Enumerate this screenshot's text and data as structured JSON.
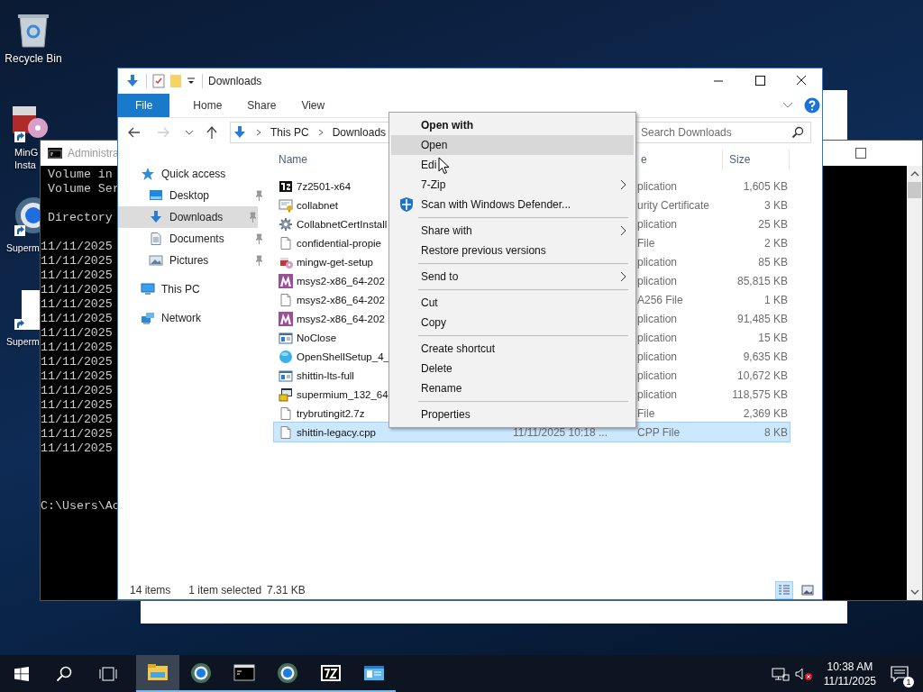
{
  "desktop_icons": [
    {
      "kind": "recycle",
      "lines": [
        "Recycle Bin"
      ]
    },
    {
      "kind": "installer",
      "lines": [
        "MinG",
        "Insta"
      ]
    },
    {
      "kind": "browser",
      "lines": [
        "Superm"
      ]
    },
    {
      "kind": "blank",
      "lines": [
        "Superm"
      ]
    }
  ],
  "console": {
    "title": "Administra",
    "header_lines": [
      "Volume in",
      "Volume Ser"
    ],
    "directory": "Directory",
    "listing": [
      "11/11/2025",
      "11/11/2025",
      "11/11/2025",
      "11/11/2025",
      "11/11/2025",
      "11/11/2025",
      "11/11/2025",
      "11/11/2025",
      "11/11/2025",
      "11/11/2025",
      "11/11/2025",
      "11/11/2025",
      "11/11/2025",
      "11/11/2025",
      "11/11/2025"
    ],
    "prompt": "C:\\Users\\Ac"
  },
  "explorer": {
    "title": "Downloads",
    "ribbon_tabs": [
      {
        "label": "File",
        "kind": "file"
      },
      {
        "label": "Home",
        "kind": "tab"
      },
      {
        "label": "Share",
        "kind": "tab"
      },
      {
        "label": "View",
        "kind": "tab"
      }
    ],
    "address": {
      "crumbs": [
        "This PC",
        "Downloads"
      ]
    },
    "search": {
      "placeholder": "Search Downloads"
    },
    "nav": [
      {
        "label": "Quick access",
        "kind": "star",
        "selected": false,
        "children": [
          {
            "label": "Desktop",
            "kind": "desktop",
            "pinned": true,
            "selected": false
          },
          {
            "label": "Downloads",
            "kind": "downloads",
            "pinned": true,
            "selected": true
          },
          {
            "label": "Documents",
            "kind": "documents",
            "pinned": true,
            "selected": false
          },
          {
            "label": "Pictures",
            "kind": "pictures",
            "pinned": true,
            "selected": false
          }
        ]
      },
      {
        "label": "This PC",
        "kind": "pc",
        "selected": false
      },
      {
        "label": "Network",
        "kind": "network",
        "selected": false
      }
    ],
    "columns": [
      "Name",
      "e",
      "Size"
    ],
    "files": [
      {
        "name": "7z2501-x64",
        "kind": "sevenzip",
        "type": "plication",
        "size": "1,605 KB",
        "selected": false
      },
      {
        "name": "collabnet",
        "kind": "cert",
        "type": "urity Certificate",
        "size": "3 KB",
        "selected": false
      },
      {
        "name": "CollabnetCertInstall",
        "kind": "gear",
        "type": "plication",
        "size": "25 KB",
        "selected": false
      },
      {
        "name": "confidential-propie",
        "kind": "doc",
        "type": "File",
        "size": "2 KB",
        "selected": false
      },
      {
        "name": "mingw-get-setup",
        "kind": "installer",
        "type": "plication",
        "size": "85 KB",
        "selected": false
      },
      {
        "name": "msys2-x86_64-202",
        "kind": "msys",
        "type": "plication",
        "size": "85,815 KB",
        "selected": false
      },
      {
        "name": "msys2-x86_64-202",
        "kind": "doc",
        "type": "A256 File",
        "size": "1 KB",
        "selected": false
      },
      {
        "name": "msys2-x86_64-202",
        "kind": "msys",
        "type": "plication",
        "size": "91,485 KB",
        "selected": false
      },
      {
        "name": "NoClose",
        "kind": "app",
        "type": "plication",
        "size": "15 KB",
        "selected": false
      },
      {
        "name": "OpenShellSetup_4_",
        "kind": "orb",
        "type": "plication",
        "size": "9,635 KB",
        "selected": false
      },
      {
        "name": "shittin-lts-full",
        "kind": "app",
        "type": "plication",
        "size": "10,672 KB",
        "selected": false
      },
      {
        "name": "supermium_132_64",
        "kind": "setup",
        "type": "plication",
        "size": "118,575 KB",
        "selected": false
      },
      {
        "name": "trybrutingit2.7z",
        "kind": "doc",
        "type": "File",
        "size": "2,369 KB",
        "selected": false
      },
      {
        "name": "shittin-legacy.cpp",
        "kind": "doc",
        "date": "11/11/2025 10:18 ...",
        "type": "CPP File",
        "size": "8 KB",
        "selected": true
      }
    ],
    "status": {
      "count": "14 items",
      "selection": "1 item selected",
      "size": "7.31 KB"
    },
    "views": [
      {
        "kind": "details",
        "selected": true
      },
      {
        "kind": "large",
        "selected": false
      }
    ]
  },
  "context_menu": [
    {
      "kind": "header",
      "label": "Open with",
      "highlighted": false,
      "submenu": false
    },
    {
      "kind": "item",
      "label": "Open",
      "highlighted": true,
      "submenu": false
    },
    {
      "kind": "item",
      "label": "Edi",
      "highlighted": false,
      "submenu": false
    },
    {
      "kind": "item",
      "label": "7-Zip",
      "highlighted": false,
      "submenu": true
    },
    {
      "kind": "defender",
      "label": "Scan with Windows Defender...",
      "highlighted": false,
      "submenu": false
    },
    {
      "kind": "separator"
    },
    {
      "kind": "item",
      "label": "Share with",
      "highlighted": false,
      "submenu": true
    },
    {
      "kind": "item",
      "label": "Restore previous versions",
      "highlighted": false,
      "submenu": false
    },
    {
      "kind": "separator"
    },
    {
      "kind": "item",
      "label": "Send to",
      "highlighted": false,
      "submenu": true
    },
    {
      "kind": "separator"
    },
    {
      "kind": "item",
      "label": "Cut",
      "highlighted": false,
      "submenu": false
    },
    {
      "kind": "item",
      "label": "Copy",
      "highlighted": false,
      "submenu": false
    },
    {
      "kind": "separator"
    },
    {
      "kind": "item",
      "label": "Create shortcut",
      "highlighted": false,
      "submenu": false
    },
    {
      "kind": "item",
      "label": "Delete",
      "highlighted": false,
      "submenu": false
    },
    {
      "kind": "item",
      "label": "Rename",
      "highlighted": false,
      "submenu": false
    },
    {
      "kind": "separator"
    },
    {
      "kind": "item",
      "label": "Properties",
      "highlighted": false,
      "submenu": false
    }
  ],
  "taskbar": {
    "apps": [
      {
        "kind": "explorer",
        "active": true
      },
      {
        "kind": "browser",
        "active": false
      },
      {
        "kind": "console",
        "active": false
      },
      {
        "kind": "browser",
        "active": false
      },
      {
        "kind": "sevenzip",
        "active": false
      },
      {
        "kind": "app",
        "active": false
      }
    ],
    "time": "10:38 AM",
    "date": "11/11/2025",
    "notifications": "1"
  }
}
